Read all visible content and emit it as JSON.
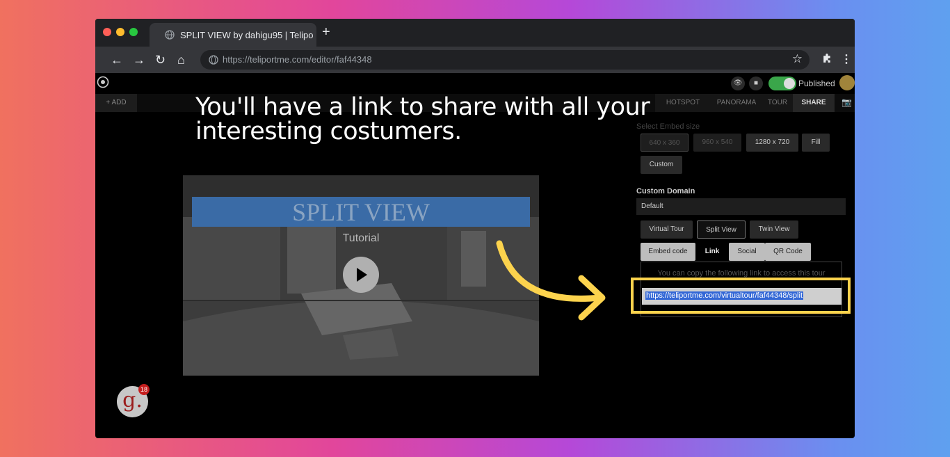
{
  "browser": {
    "tab_title": "SPLIT VIEW by dahigu95 | Telipo",
    "new_tab_label": "+",
    "url": "https://teliportme.com/editor/faf44348",
    "nav": {
      "back": "←",
      "forward": "→",
      "reload": "↻",
      "home": "⌂"
    },
    "bookmark_icon": "☆",
    "extensions_icon": "puzzle-icon",
    "menu_icon": "⋮"
  },
  "app": {
    "published_label": "Published",
    "add_label": "+ ADD",
    "tabs": [
      {
        "label": "HOTSPOT"
      },
      {
        "label": "PANORAMA"
      },
      {
        "label": "TOUR"
      },
      {
        "label": "SHARE"
      }
    ]
  },
  "tutorial": {
    "heading_line1": "You'll have a link to share with all your",
    "heading_line2": "interesting costumers."
  },
  "video": {
    "banner_title": "SPLIT VIEW",
    "subtitle": "Tutorial"
  },
  "share": {
    "embed_size_label": "Select Embed size",
    "sizes": [
      "640 x 360",
      "960 x 540",
      "1280 x 720",
      "Fill",
      "Custom"
    ],
    "custom_domain_label": "Custom Domain",
    "domain_value": "Default",
    "views": [
      "Virtual Tour",
      "Split View",
      "Twin View"
    ],
    "share_tabs": [
      "Embed code",
      "Link",
      "Social",
      "QR Code"
    ],
    "link_info": "You can copy the following link to access this tour",
    "link_url": "https://teliportme.com/virtualtour/faf44348/split"
  },
  "badge": {
    "letter": "g.",
    "count": "18"
  },
  "colors": {
    "highlight": "#fcd34d",
    "toggle_on": "#3aa64a"
  }
}
